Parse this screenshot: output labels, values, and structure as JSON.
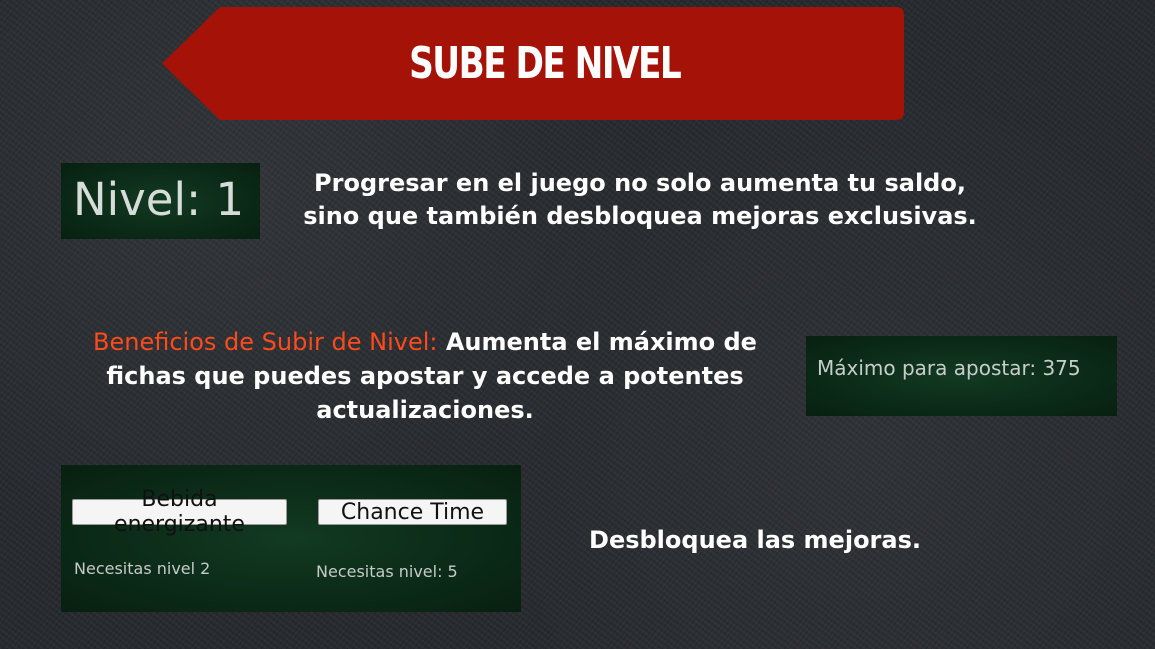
{
  "banner": {
    "title": "SUBE DE NIVEL",
    "color": "#a51208"
  },
  "level_panel": {
    "text": "Nivel: 1"
  },
  "intro_text": "Progresar en el juego no solo aumenta tu saldo, sino que también desbloquea mejoras exclusivas.",
  "benefits": {
    "heading": "Beneficios de Subir de Nivel:",
    "heading_color": "#ff4a1c",
    "body": " Aumenta el máximo de fichas que puedes apostar y accede a potentes actualizaciones."
  },
  "max_bet_panel": {
    "text": "Máximo para apostar: 375"
  },
  "upgrades_panel": {
    "items": [
      {
        "button_label": "Bebida energizante",
        "requirement": "Necesitas nivel 2"
      },
      {
        "button_label": "Chance Time",
        "requirement": "Necesitas nivel: 5"
      }
    ]
  },
  "unlock_text": "Desbloquea las mejoras."
}
